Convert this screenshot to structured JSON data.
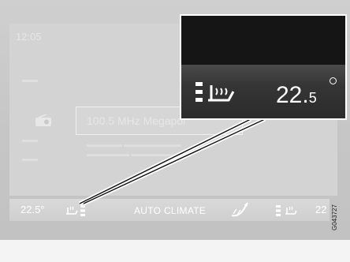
{
  "background_screen": {
    "time": "12:05",
    "station": "100.5 MHz Megapol"
  },
  "climate_bar": {
    "left_temp": "22.5°",
    "center_label": "AUTO CLIMATE",
    "right_temp": "22",
    "icons": [
      "seat-heating-left-icon",
      "fan-icon",
      "seat-heating-right-icon"
    ]
  },
  "callout": {
    "temp_whole": "22.",
    "temp_decimal": "5",
    "icon": "seat-heating-icon"
  },
  "figure_ref": "G043727",
  "colors": {
    "climate_text": "#ffffff",
    "callout_bg": "#1a1a1a"
  }
}
